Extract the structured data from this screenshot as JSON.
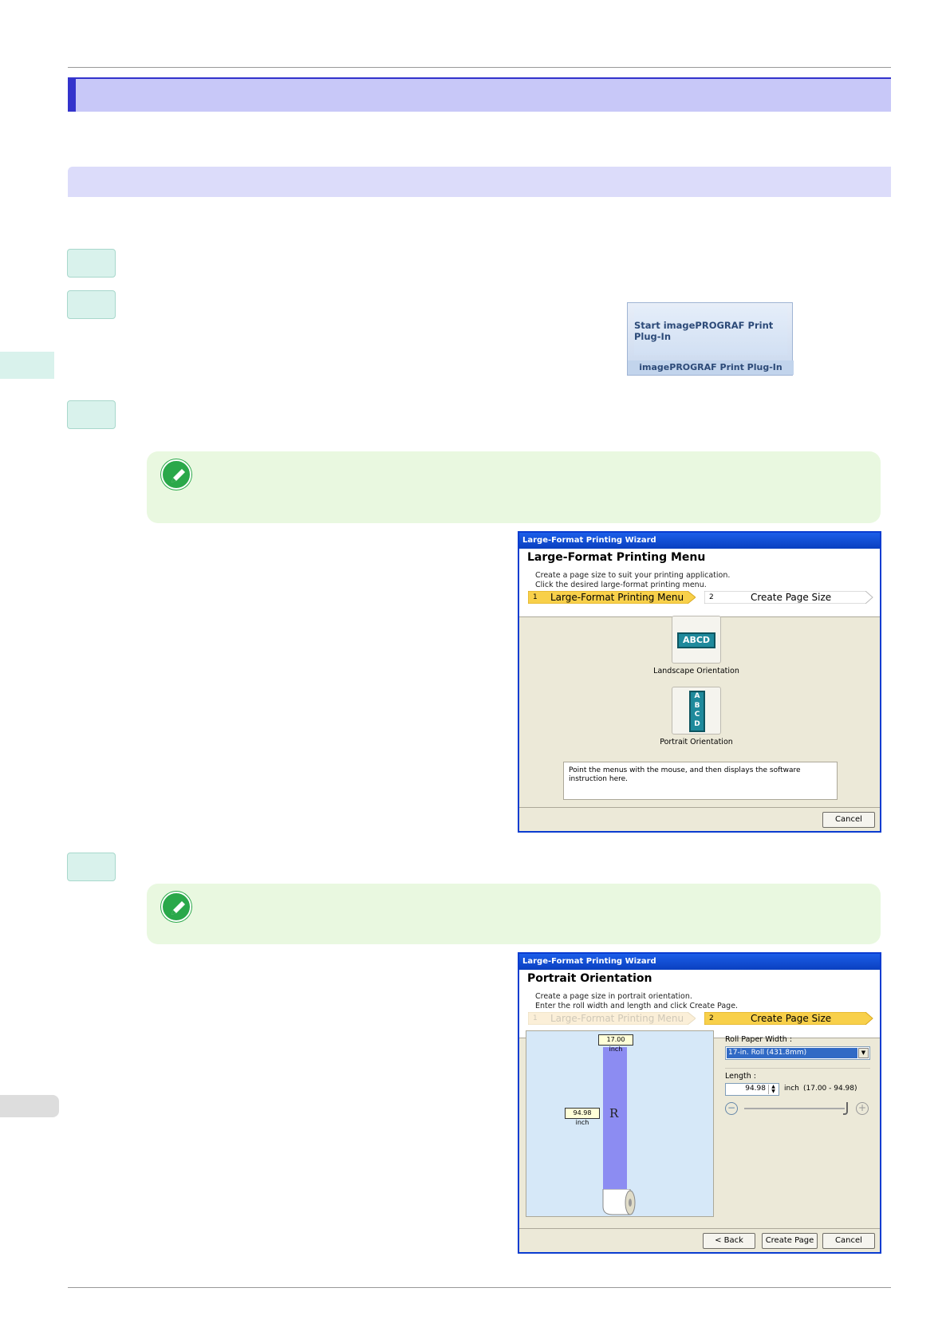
{
  "ribbon": {
    "button_label": "Start imagePROGRAF Print Plug-In",
    "group_label": "imagePROGRAF Print Plug-In"
  },
  "dialog1": {
    "window_title": "Large-Format Printing Wizard",
    "heading": "Large-Format Printing Menu",
    "subtitle_line1": "Create a page size to suit your printing application.",
    "subtitle_line2": "Click the desired large-format printing menu.",
    "step1_num": "1",
    "step1_label": "Large-Format Printing Menu",
    "step2_num": "2",
    "step2_label": "Create Page Size",
    "landscape_icon_text": "ABCD",
    "landscape_label": "Landscape Orientation",
    "portrait_icon_letters": [
      "A",
      "B",
      "C",
      "D"
    ],
    "portrait_label": "Portrait Orientation",
    "info_text": "Point the menus with the mouse, and then displays the software instruction here.",
    "cancel_label": "Cancel"
  },
  "dialog2": {
    "window_title": "Large-Format Printing Wizard",
    "heading": "Portrait Orientation",
    "subtitle_line1": "Create a page size in portrait orientation.",
    "subtitle_line2": "Enter the roll width and length and click Create Page.",
    "step1_num": "1",
    "step1_label": "Large-Format Printing Menu",
    "step2_num": "2",
    "step2_label": "Create Page Size",
    "width_tag": "17.00 inch",
    "length_tag": "94.98 inch",
    "preview_glyph": "R",
    "roll_width_label": "Roll Paper Width :",
    "roll_width_value": "17-in. Roll (431.8mm)",
    "length_label": "Length :",
    "length_value": "94.98",
    "length_unit": "inch",
    "length_range": "(17.00 - 94.98)",
    "back_label": "< Back",
    "create_label": "Create Page",
    "cancel_label": "Cancel"
  }
}
